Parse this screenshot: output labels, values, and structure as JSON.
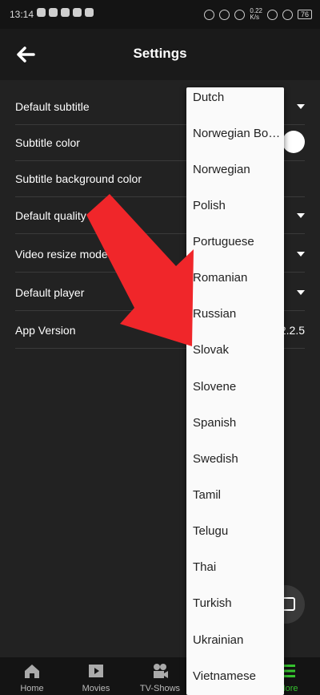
{
  "status_bar": {
    "time": "13:14",
    "network_speed": "0.22\nK/s",
    "battery": "76"
  },
  "app_bar": {
    "title": "Settings"
  },
  "settings": [
    {
      "label": "Default subtitle",
      "control": "dropdown"
    },
    {
      "label": "Subtitle color",
      "control": "toggle"
    },
    {
      "label": "Subtitle background color",
      "control": "none"
    },
    {
      "label": "Default quality",
      "control": "dropdown"
    },
    {
      "label": "Video resize mode",
      "control": "dropdown"
    },
    {
      "label": "Default player",
      "control": "dropdown"
    },
    {
      "label": "App Version",
      "value": "2.2.5"
    }
  ],
  "dropdown_options": [
    "Dutch",
    "Norwegian Bo…",
    "Norwegian",
    "Polish",
    "Portuguese",
    "Romanian",
    "Russian",
    "Slovak",
    "Slovene",
    "Spanish",
    "Swedish",
    "Tamil",
    "Telugu",
    "Thai",
    "Turkish",
    "Ukrainian",
    "Vietnamese"
  ],
  "bottom_nav": [
    {
      "label": "Home",
      "icon": "home-icon"
    },
    {
      "label": "Movies",
      "icon": "movies-icon"
    },
    {
      "label": "TV-Shows",
      "icon": "tv-shows-icon"
    },
    {
      "label": "",
      "icon": ""
    },
    {
      "label": "More",
      "icon": "menu-icon",
      "active": true
    }
  ],
  "colors": {
    "accent": "#35c22e",
    "arrow": "#f0262a",
    "background": "#222222"
  }
}
